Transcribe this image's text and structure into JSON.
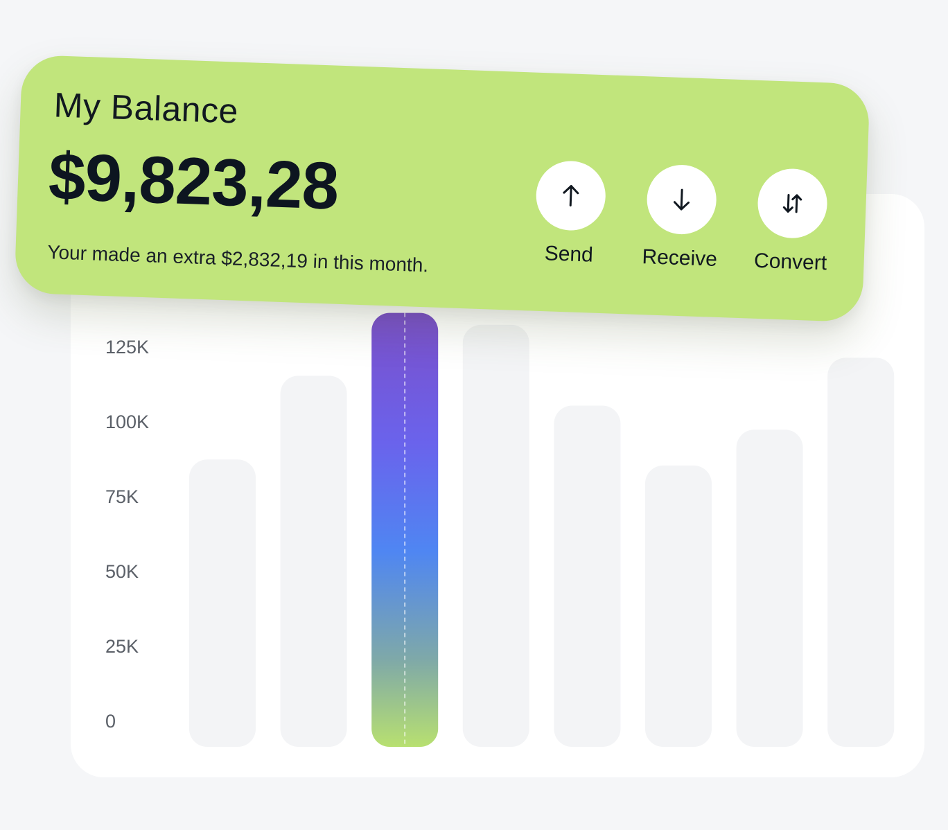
{
  "balance": {
    "title": "My Balance",
    "amount": "$9,823,28",
    "subtitle": "Your made an extra $2,832,19 in this month.",
    "actions": [
      {
        "label": "Send",
        "icon": "arrow-up-icon"
      },
      {
        "label": "Receive",
        "icon": "arrow-down-icon"
      },
      {
        "label": "Convert",
        "icon": "swap-vertical-icon"
      }
    ]
  },
  "colors": {
    "card_background": "#c1e57c",
    "highlight_gradient": [
      "#7b4fc9",
      "#6a63ec",
      "#4f86f2",
      "#7fa9a8",
      "#b8e070"
    ]
  },
  "chart_data": {
    "type": "bar",
    "title": "",
    "xlabel": "",
    "ylabel": "",
    "y_ticks": [
      "0",
      "25K",
      "50K",
      "75K",
      "100K",
      "125K"
    ],
    "ylim": [
      0,
      150000
    ],
    "categories": [
      "",
      "",
      "",
      "",
      "",
      "",
      "",
      ""
    ],
    "values": [
      96000,
      124000,
      145000,
      141000,
      114000,
      94000,
      106000,
      130000
    ],
    "highlighted_index": 2,
    "grid": false
  }
}
